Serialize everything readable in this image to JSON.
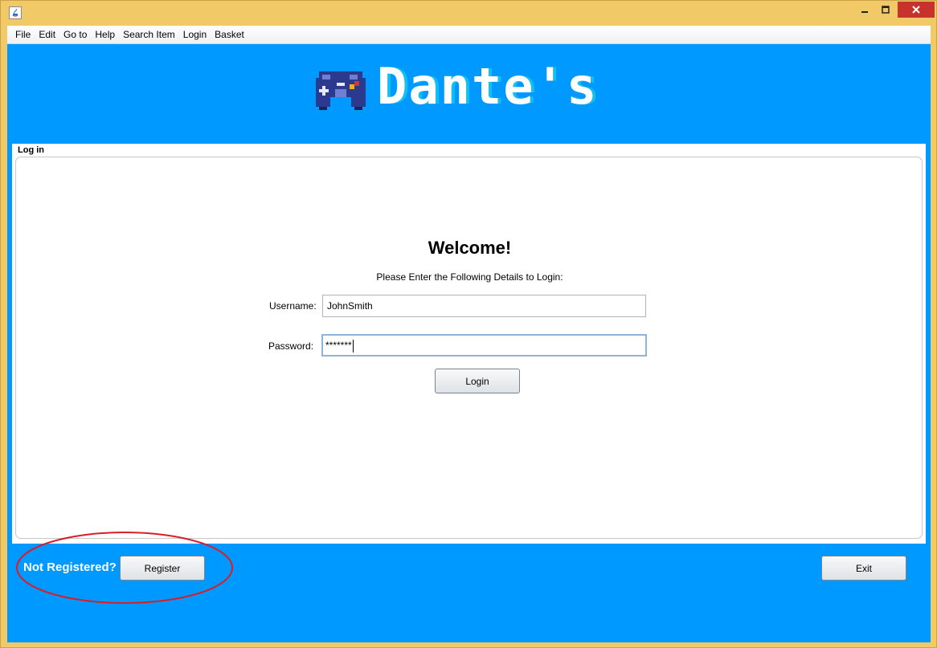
{
  "window": {
    "title": "",
    "controls": {
      "minimize": "—",
      "maximize": "☐",
      "close": "✕"
    }
  },
  "menubar": {
    "items": [
      "File",
      "Edit",
      "Go to",
      "Help",
      "Search Item",
      "Login",
      "Basket"
    ]
  },
  "header": {
    "logo_text": "Dante's",
    "logo_icon": "gamepad-icon"
  },
  "login_panel": {
    "title": "Log in",
    "welcome": "Welcome!",
    "instruction": "Please Enter the Following Details to Login:",
    "username_label": "Username:",
    "username_value": "JohnSmith",
    "password_label": "Password:",
    "password_value": "*******",
    "login_button": "Login"
  },
  "footer": {
    "not_registered": "Not Registered?",
    "register_button": "Register",
    "exit_button": "Exit"
  },
  "colors": {
    "background": "#0099ff",
    "window_frame": "#f2c967",
    "annotation": "#d81e2a"
  }
}
